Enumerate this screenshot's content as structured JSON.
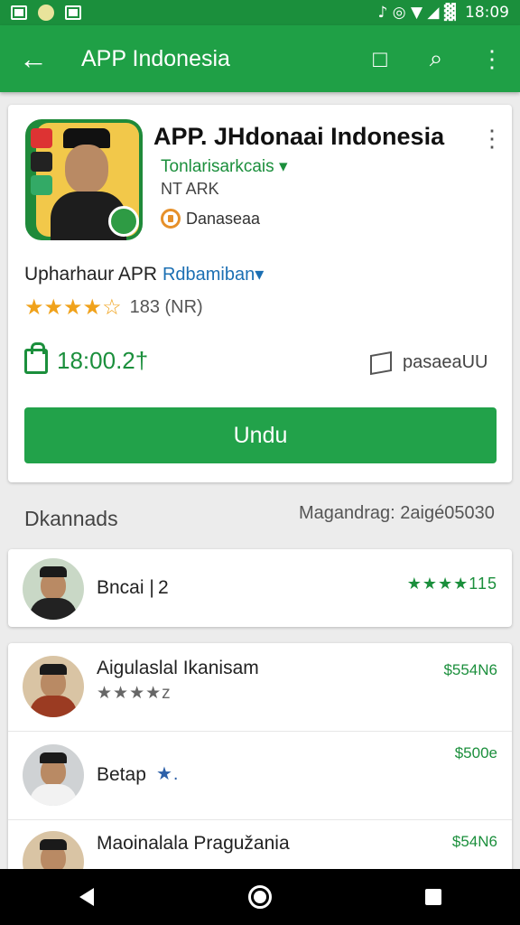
{
  "status_bar": {
    "time": "18:09",
    "indicators": "♪ ◎ ▼ ◢ ▓"
  },
  "app_bar": {
    "title": "APP Indonesia",
    "back_icon": "←",
    "device_icon": "□",
    "search_icon": "⌕",
    "more_icon": "⋮"
  },
  "app": {
    "title": "APP. JHdonaai Indonesia",
    "developer": "Tonlarisarkcais",
    "subcategory": "NT ARK",
    "badge": "Danaseaa",
    "rating_label": "Upharhaur APR",
    "rating_link": "Rdbamiban",
    "stars": "★★★★☆",
    "rating_count": "183 (NR)",
    "price": "18:00.2†",
    "size": "pasaeaUU",
    "install_label": "Undu",
    "more_icon": "⋮"
  },
  "downloads": {
    "heading": "Dkannads",
    "meta": "Magandrag: 2aigé05030"
  },
  "featured_row": {
    "title": "Bncai | 2",
    "rating": "★★★★115"
  },
  "list": [
    {
      "title": "Aigulaslal Ikanisam",
      "sub": "★★★★z",
      "right": "$554N6"
    },
    {
      "title": "Betap",
      "sub": "★.",
      "right": "$500e"
    },
    {
      "title": "Maoinalala Pragužania",
      "sub": "",
      "right": "$54N6"
    }
  ],
  "colors": {
    "primary": "#1fa046",
    "dark_primary": "#1b8f3c",
    "star": "#f0a21b"
  }
}
